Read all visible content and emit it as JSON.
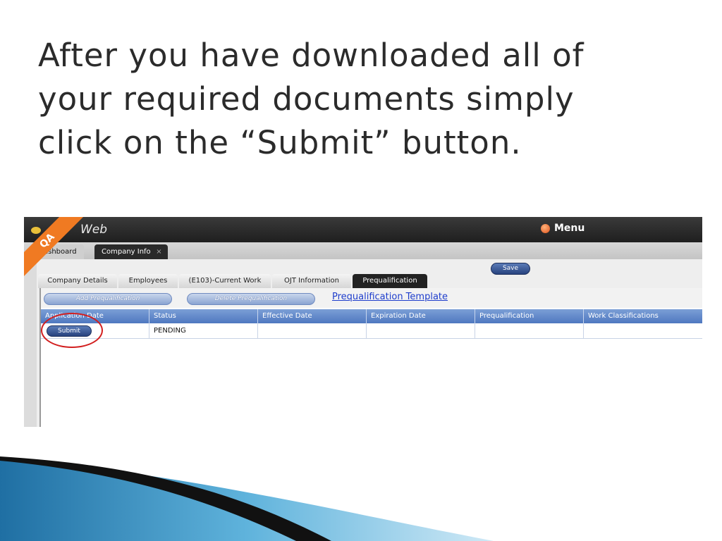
{
  "slide": {
    "title_lines": [
      "After you have downloaded all of",
      "your required documents simply",
      "click on the “Submit” button."
    ]
  },
  "app": {
    "brand": "Web",
    "ribbon": "QA",
    "menu_label": "Menu",
    "main_tabs": [
      {
        "label": "ashboard"
      },
      {
        "label": "Company Info",
        "close": "×"
      }
    ],
    "save_label": "Save",
    "sub_tabs": [
      {
        "label": "Company Details"
      },
      {
        "label": "Employees"
      },
      {
        "label": "(E103)-Current Work"
      },
      {
        "label": "OJT Information"
      },
      {
        "label": "Prequalification",
        "active": true
      }
    ],
    "actions": {
      "add": "Add Prequalification",
      "delete": "Delete Prequalification",
      "template_link": "Prequalification Template"
    },
    "grid": {
      "columns": [
        "Application Date",
        "Status",
        "Effective Date",
        "Expiration Date",
        "Prequalification",
        "Work Classifications"
      ],
      "rows": [
        {
          "application_date_button": "Submit",
          "status": "PENDING",
          "effective_date": "",
          "expiration_date": "",
          "prequalification": "",
          "work_classifications": ""
        }
      ]
    }
  },
  "colors": {
    "ribbon": "#f07a22",
    "highlight": "#d21f1f",
    "grid_header": "#5a80c4",
    "link": "#1e3dcc"
  }
}
